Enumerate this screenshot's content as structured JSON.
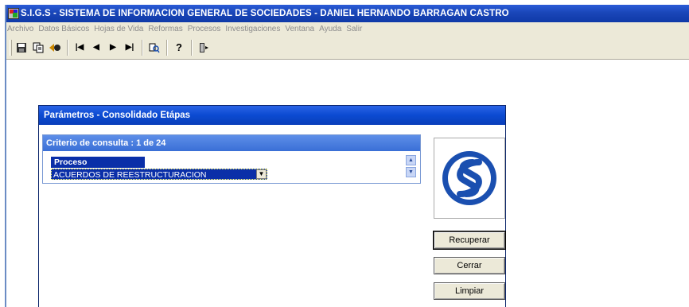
{
  "window": {
    "title": "S.I.G.S   - SISTEMA DE INFORMACION GENERAL DE SOCIEDADES - DANIEL HERNANDO BARRAGAN CASTRO"
  },
  "menu": [
    {
      "label": "Archivo"
    },
    {
      "label": "Datos Básicos"
    },
    {
      "label": "Hojas de Vida"
    },
    {
      "label": "Reformas"
    },
    {
      "label": "Procesos"
    },
    {
      "label": "Investigaciones"
    },
    {
      "label": "Ventana"
    },
    {
      "label": "Ayuda"
    },
    {
      "label": "Salir"
    }
  ],
  "toolbar": {
    "icons": [
      "save-icon",
      "copy-icon",
      "back-icon",
      "first-record-icon",
      "previous-record-icon",
      "next-record-icon",
      "last-record-icon",
      "search-icon",
      "help-icon",
      "exit-icon"
    ]
  },
  "dialog": {
    "title": "Parámetros - Consolidado Etápas",
    "criteria": {
      "header": "Criterio de consulta : 1  de  24",
      "field_label": "Proceso",
      "selected_value": "ACUERDOS DE REESTRUCTURACION"
    },
    "buttons": {
      "recuperar": "Recuperar",
      "cerrar": "Cerrar",
      "limpiar": "Limpiar"
    }
  },
  "colors": {
    "titlebar": "#0f3aa8",
    "selection": "#0a2fa8",
    "logo": "#1a4fb0"
  }
}
